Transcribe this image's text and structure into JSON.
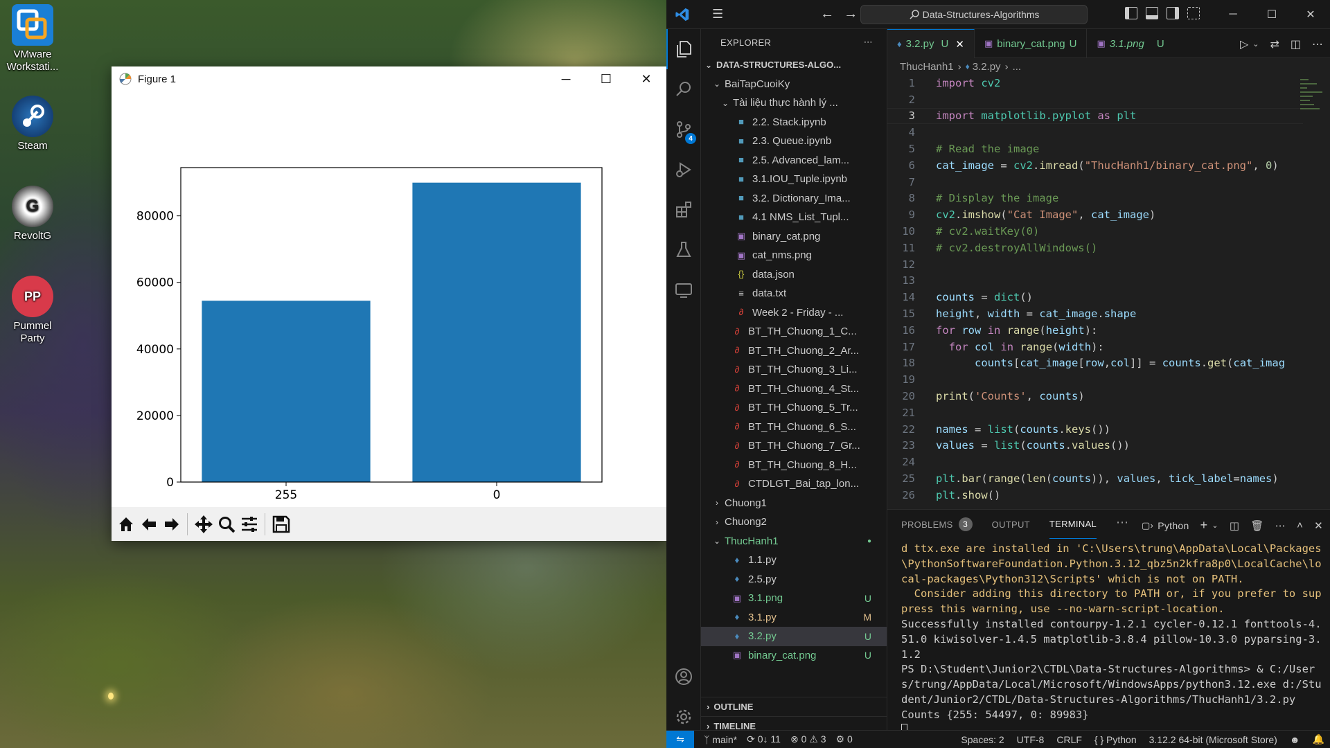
{
  "desktop": {
    "icons": [
      {
        "label": "VMware Workstati...",
        "icon": "vmware-icon"
      },
      {
        "label": "Steam",
        "icon": "steam-icon"
      },
      {
        "label": "RevoltG",
        "icon": "revoltg-icon"
      },
      {
        "label": "Pummel Party",
        "icon": "pummel-party-icon"
      }
    ]
  },
  "figure": {
    "title": "Figure 1",
    "toolbar": [
      "home-icon",
      "back-icon",
      "forward-icon",
      "pan-icon",
      "zoom-icon",
      "configure-subplots-icon",
      "save-icon"
    ]
  },
  "chart_data": {
    "type": "bar",
    "categories": [
      "255",
      "0"
    ],
    "values": [
      54497,
      89983
    ],
    "ylim": [
      0,
      94500
    ],
    "yticks": [
      0,
      20000,
      40000,
      60000,
      80000
    ],
    "bar_color": "#1f77b4",
    "grid": false
  },
  "vscode": {
    "search_text": "Data-Structures-Algorithms",
    "explorer_title": "EXPLORER",
    "root": "DATA-STRUCTURES-ALGO...",
    "tree": [
      {
        "label": "BaiTapCuoiKy",
        "level": 1,
        "type": "folder-open",
        "status": ""
      },
      {
        "label": "Tài liệu thực hành lý ...",
        "level": 2,
        "type": "folder-open",
        "status": ""
      },
      {
        "label": "2.2. Stack.ipynb",
        "level": 3,
        "type": "notebook",
        "status": ""
      },
      {
        "label": "2.3. Queue.ipynb",
        "level": 3,
        "type": "notebook",
        "status": ""
      },
      {
        "label": "2.5. Advanced_lam...",
        "level": 3,
        "type": "notebook",
        "status": ""
      },
      {
        "label": "3.1.IOU_Tuple.ipynb",
        "level": 3,
        "type": "notebook",
        "status": ""
      },
      {
        "label": "3.2. Dictionary_Ima...",
        "level": 3,
        "type": "notebook",
        "status": ""
      },
      {
        "label": "4.1 NMS_List_Tupl...",
        "level": 3,
        "type": "notebook",
        "status": ""
      },
      {
        "label": "binary_cat.png",
        "level": 3,
        "type": "image",
        "status": ""
      },
      {
        "label": "cat_nms.png",
        "level": 3,
        "type": "image",
        "status": ""
      },
      {
        "label": "data.json",
        "level": 3,
        "type": "json",
        "status": ""
      },
      {
        "label": "data.txt",
        "level": 3,
        "type": "text",
        "status": ""
      },
      {
        "label": "Week 2 - Friday - ...",
        "level": 3,
        "type": "pdf",
        "status": ""
      },
      {
        "label": "BT_TH_Chuong_1_C...",
        "level": 2,
        "type": "pdf",
        "status": ""
      },
      {
        "label": "BT_TH_Chuong_2_Ar...",
        "level": 2,
        "type": "pdf",
        "status": ""
      },
      {
        "label": "BT_TH_Chuong_3_Li...",
        "level": 2,
        "type": "pdf",
        "status": ""
      },
      {
        "label": "BT_TH_Chuong_4_St...",
        "level": 2,
        "type": "pdf",
        "status": ""
      },
      {
        "label": "BT_TH_Chuong_5_Tr...",
        "level": 2,
        "type": "pdf",
        "status": ""
      },
      {
        "label": "BT_TH_Chuong_6_S...",
        "level": 2,
        "type": "pdf",
        "status": ""
      },
      {
        "label": "BT_TH_Chuong_7_Gr...",
        "level": 2,
        "type": "pdf",
        "status": ""
      },
      {
        "label": "BT_TH_Chuong_8_H...",
        "level": 2,
        "type": "pdf",
        "status": ""
      },
      {
        "label": "CTDLGT_Bai_tap_lon...",
        "level": 2,
        "type": "pdf",
        "status": ""
      },
      {
        "label": "Chuong1",
        "level": 1,
        "type": "folder",
        "status": ""
      },
      {
        "label": "Chuong2",
        "level": 1,
        "type": "folder",
        "status": ""
      },
      {
        "label": "ThucHanh1",
        "level": 1,
        "type": "folder-open",
        "status": "dot",
        "color": "green"
      },
      {
        "label": "1.1.py",
        "level": 2,
        "type": "python",
        "status": ""
      },
      {
        "label": "2.5.py",
        "level": 2,
        "type": "python",
        "status": ""
      },
      {
        "label": "3.1.png",
        "level": 2,
        "type": "image",
        "status": "U",
        "color": "green"
      },
      {
        "label": "3.1.py",
        "level": 2,
        "type": "python",
        "status": "M",
        "color": "yellow"
      },
      {
        "label": "3.2.py",
        "level": 2,
        "type": "python",
        "status": "U",
        "color": "green",
        "selected": true
      },
      {
        "label": "binary_cat.png",
        "level": 2,
        "type": "image",
        "status": "U",
        "color": "green"
      }
    ],
    "outline_label": "OUTLINE",
    "timeline_label": "TIMELINE",
    "tabs": [
      {
        "label": "3.2.py",
        "status": "U",
        "active": true,
        "italic": false
      },
      {
        "label": "binary_cat.png",
        "status": "U",
        "active": false,
        "italic": false
      },
      {
        "label": "3.1.png",
        "status": "U",
        "active": false,
        "italic": true
      }
    ],
    "breadcrumb": [
      "ThucHanh1",
      "3.2.py",
      "..."
    ],
    "current_line": 3,
    "code_lines": [
      {
        "n": "1",
        "html": "<span class='kw'>import</span> <span class='ty'>cv2</span>"
      },
      {
        "n": "2",
        "html": ""
      },
      {
        "n": "3",
        "html": "<span class='kw'>import</span> <span class='ty'>matplotlib.pyplot</span> <span class='kw'>as</span> <span class='ty'>plt</span>"
      },
      {
        "n": "4",
        "html": ""
      },
      {
        "n": "5",
        "html": "<span class='cm'># Read the image</span>"
      },
      {
        "n": "6",
        "html": "<span class='var'>cat_image</span> = <span class='ty'>cv2</span>.<span class='fn'>imread</span>(<span class='str'>\"ThucHanh1/binary_cat.png\"</span>, <span class='num'>0</span>)"
      },
      {
        "n": "7",
        "html": ""
      },
      {
        "n": "8",
        "html": "<span class='cm'># Display the image</span>"
      },
      {
        "n": "9",
        "html": "<span class='ty'>cv2</span>.<span class='fn'>imshow</span>(<span class='str'>\"Cat Image\"</span>, <span class='var'>cat_image</span>)"
      },
      {
        "n": "10",
        "html": "<span class='cm'># cv2.waitKey(0)</span>"
      },
      {
        "n": "11",
        "html": "<span class='cm'># cv2.destroyAllWindows()</span>"
      },
      {
        "n": "12",
        "html": ""
      },
      {
        "n": "13",
        "html": ""
      },
      {
        "n": "14",
        "html": "<span class='var'>counts</span> = <span class='ty'>dict</span>()"
      },
      {
        "n": "15",
        "html": "<span class='var'>height</span>, <span class='var'>width</span> = <span class='var'>cat_image</span>.<span class='var'>shape</span>"
      },
      {
        "n": "16",
        "html": "<span class='kw'>for</span> <span class='var'>row</span> <span class='kw'>in</span> <span class='fn'>range</span>(<span class='var'>height</span>):"
      },
      {
        "n": "17",
        "html": "  <span class='kw'>for</span> <span class='var'>col</span> <span class='kw'>in</span> <span class='fn'>range</span>(<span class='var'>width</span>):"
      },
      {
        "n": "18",
        "html": "      <span class='var'>counts</span>[<span class='var'>cat_image</span>[<span class='var'>row</span>,<span class='var'>col</span>]] = <span class='var'>counts</span>.<span class='fn'>get</span>(<span class='var'>cat_imag</span>"
      },
      {
        "n": "19",
        "html": ""
      },
      {
        "n": "20",
        "html": "<span class='fn'>print</span>(<span class='str'>'Counts'</span>, <span class='var'>counts</span>)"
      },
      {
        "n": "21",
        "html": ""
      },
      {
        "n": "22",
        "html": "<span class='var'>names</span> = <span class='ty'>list</span>(<span class='var'>counts</span>.<span class='fn'>keys</span>())"
      },
      {
        "n": "23",
        "html": "<span class='var'>values</span> = <span class='ty'>list</span>(<span class='var'>counts</span>.<span class='fn'>values</span>())"
      },
      {
        "n": "24",
        "html": ""
      },
      {
        "n": "25",
        "html": "<span class='ty'>plt</span>.<span class='fn'>bar</span>(<span class='fn'>range</span>(<span class='fn'>len</span>(<span class='var'>counts</span>)), <span class='var'>values</span>, <span class='var'>tick_label</span>=<span class='var'>names</span>)"
      },
      {
        "n": "26",
        "html": "<span class='ty'>plt</span>.<span class='fn'>show</span>()"
      }
    ],
    "panel": {
      "tabs": [
        "PROBLEMS",
        "OUTPUT",
        "TERMINAL"
      ],
      "problems_count": "3",
      "active_tab": "TERMINAL",
      "shell": "Python"
    },
    "terminal_lines": [
      {
        "text": "d ttx.exe are installed in 'C:\\Users\\trung\\AppData\\Local\\Packages\\PythonSoftwareFoundation.Python.3.12_qbz5n2kfra8p0\\LocalCache\\local-packages\\Python312\\Scripts' which is not on PATH.",
        "warn": true
      },
      {
        "text": "  Consider adding this directory to PATH or, if you prefer to suppress this warning, use --no-warn-script-location.",
        "warn": true
      },
      {
        "text": "Successfully installed contourpy-1.2.1 cycler-0.12.1 fonttools-4.51.0 kiwisolver-1.4.5 matplotlib-3.8.4 pillow-10.3.0 pyparsing-3.1.2",
        "warn": false
      },
      {
        "text": "PS D:\\Student\\Junior2\\CTDL\\Data-Structures-Algorithms> & C:/Users/trung/AppData/Local/Microsoft/WindowsApps/python3.12.exe d:/Student/Junior2/CTDL/Data-Structures-Algorithms/ThucHanh1/3.2.py",
        "warn": false
      },
      {
        "text": "Counts {255: 54497, 0: 89983}",
        "warn": false
      }
    ],
    "status": {
      "branch": "main*",
      "sync": "0↓ 11",
      "errors": "0",
      "warnings": "3",
      "ports": "0",
      "spaces": "Spaces: 2",
      "encoding": "UTF-8",
      "eol": "CRLF",
      "language": "Python",
      "interpreter": "3.12.2 64-bit (Microsoft Store)"
    }
  }
}
